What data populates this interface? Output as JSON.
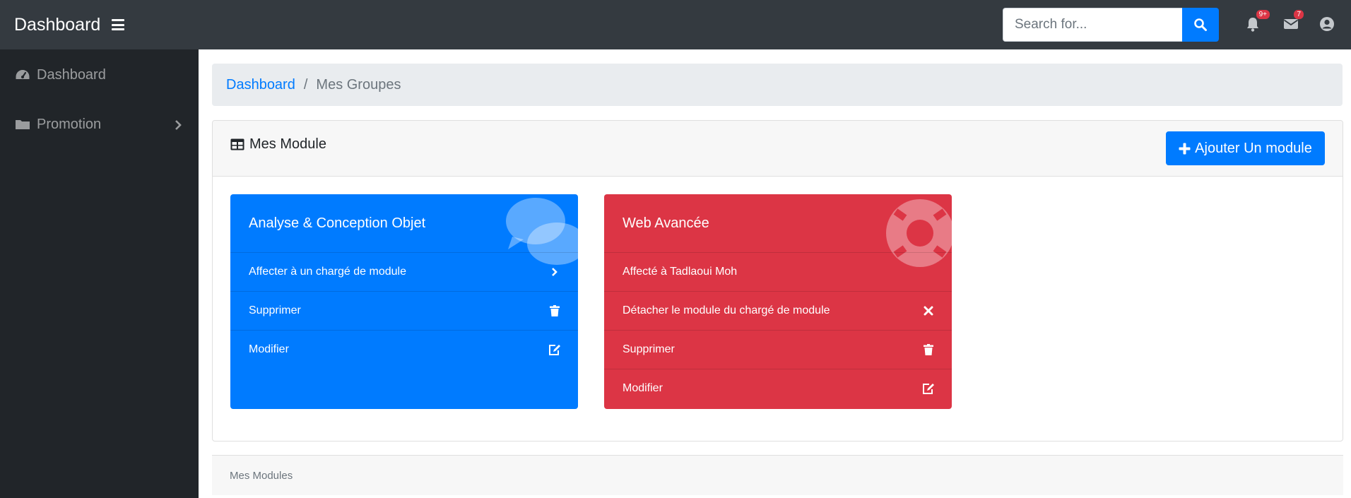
{
  "navbar": {
    "brand": "Dashboard",
    "search_placeholder": "Search for...",
    "notifications_badge": "9+",
    "messages_badge": "7"
  },
  "sidebar": {
    "items": [
      {
        "label": "Dashboard",
        "icon": "tachometer-icon"
      },
      {
        "label": "Promotion",
        "icon": "folder-icon"
      }
    ]
  },
  "breadcrumb": {
    "home": "Dashboard",
    "separator": "/",
    "current": "Mes Groupes"
  },
  "card": {
    "title": "Mes Module",
    "add_button": "Ajouter Un module",
    "footer": "Mes Modules"
  },
  "modules": [
    {
      "title": "Analyse & Conception Objet",
      "color": "#007bff",
      "bg_icon": "comments-icon",
      "actions": [
        {
          "label": "Affecter à un chargé de module",
          "icon": "chevron-right-icon"
        },
        {
          "label": "Supprimer",
          "icon": "trash-icon"
        },
        {
          "label": "Modifier",
          "icon": "edit-icon"
        }
      ]
    },
    {
      "title": "Web Avancée",
      "color": "#dc3545",
      "bg_icon": "life-ring-icon",
      "assigned": "Affecté à Tadlaoui Moh",
      "actions": [
        {
          "label": "Détacher le module du chargé de module",
          "icon": "times-icon"
        },
        {
          "label": "Supprimer",
          "icon": "trash-icon"
        },
        {
          "label": "Modifier",
          "icon": "edit-icon"
        }
      ]
    }
  ],
  "colors": {
    "navbar": "#343a40",
    "sidebar": "#212529",
    "primary": "#007bff",
    "danger": "#dc3545"
  }
}
